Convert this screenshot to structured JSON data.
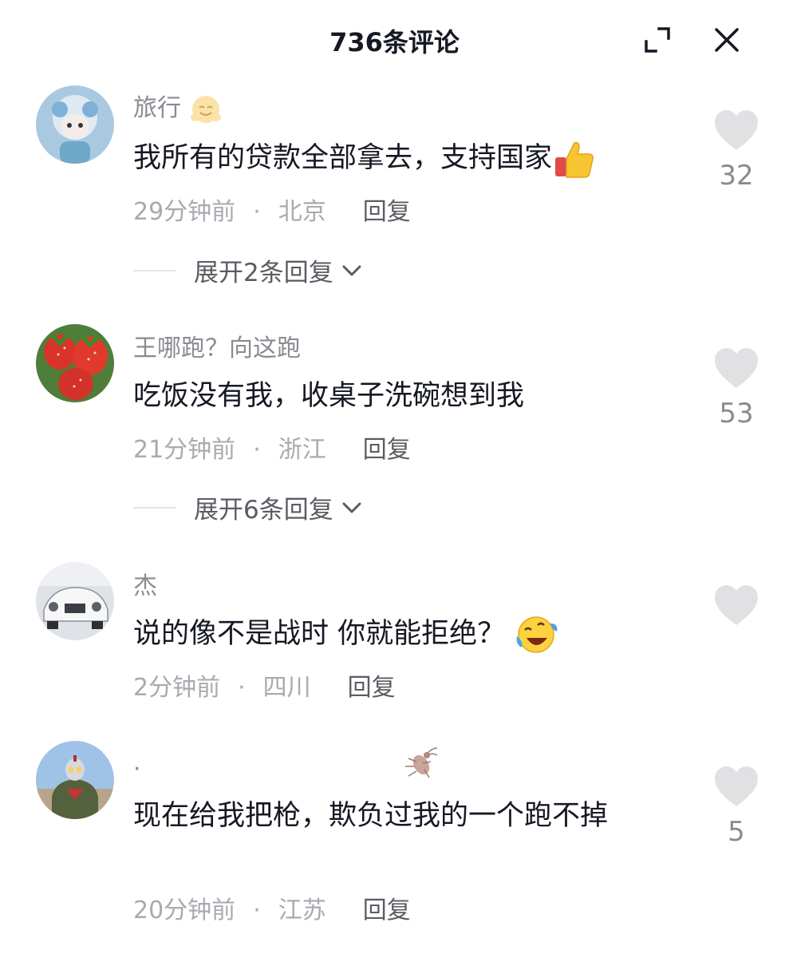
{
  "header": {
    "title": "736条评论",
    "expand_icon": "expand-icon",
    "close_icon": "close-icon"
  },
  "comments": [
    {
      "username": "旅行",
      "username_emoji": "hugging-face-emoji",
      "text": "我所有的贷款全部拿去，支持国家",
      "text_emoji": "thumbs-up-emoji",
      "time": "29分钟前",
      "location": "北京",
      "reply_label": "回复",
      "likes": "32",
      "expand_label": "展开2条回复"
    },
    {
      "username": "王哪跑？向这跑",
      "text": "吃饭没有我，收桌子洗碗想到我",
      "time": "21分钟前",
      "location": "浙江",
      "reply_label": "回复",
      "likes": "53",
      "expand_label": "展开6条回复"
    },
    {
      "username": "杰",
      "text": "说的像不是战时 你就能拒绝？",
      "text_emoji": "rolling-on-floor-laughing-emoji",
      "time": "2分钟前",
      "location": "四川",
      "reply_label": "回复",
      "likes": ""
    },
    {
      "username": ".",
      "username_emoji": "cockroach-emoji",
      "text": "现在给我把枪，欺负过我的一个跑不掉",
      "time": "20分钟前",
      "location": "江苏",
      "reply_label": "回复",
      "likes": "5"
    }
  ],
  "meta_separator": "·"
}
